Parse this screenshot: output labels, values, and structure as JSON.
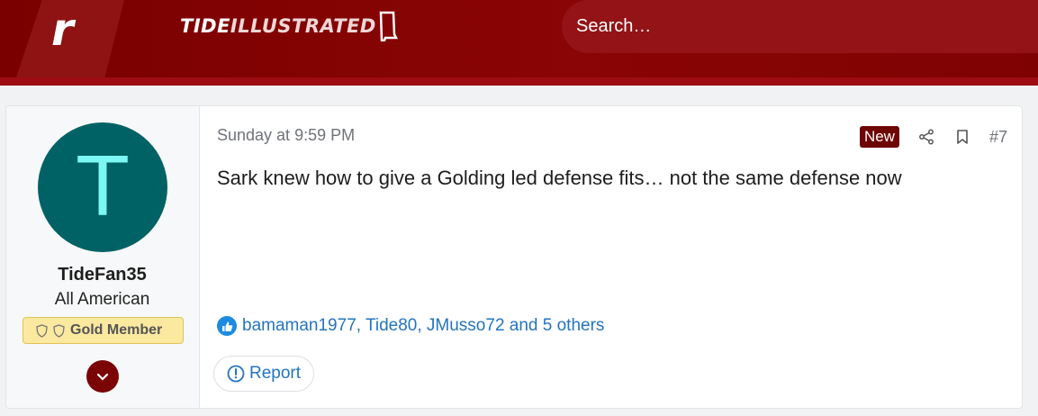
{
  "header": {
    "logo_letter": "r",
    "brand_part1": "Tide",
    "brand_part2": "Illustrated"
  },
  "search": {
    "placeholder": "Search…"
  },
  "user": {
    "avatar_letter": "T",
    "username": "TideFan35",
    "title": "All American",
    "badge": "Gold Member"
  },
  "post": {
    "date": "Sunday at 9:59 PM",
    "new_label": "New",
    "number": "#7",
    "message": "Sark knew how to give a Golding led defense fits… not the same defense now",
    "reactions": "bamaman1977, Tide80, JMusso72 and 5 others",
    "report_label": "Report"
  },
  "icons": {
    "share": "share-icon",
    "bookmark": "bookmark-icon",
    "like": "thumbs-up-icon",
    "report": "alert-circle-icon",
    "expand": "chevron-down-icon"
  },
  "colors": {
    "header": "#7a0000",
    "avatar_bg": "#006265",
    "avatar_fg": "#7cf7f4",
    "link": "#2474c0",
    "badge": "#fbe9a0",
    "new_badge": "#6f0606"
  }
}
